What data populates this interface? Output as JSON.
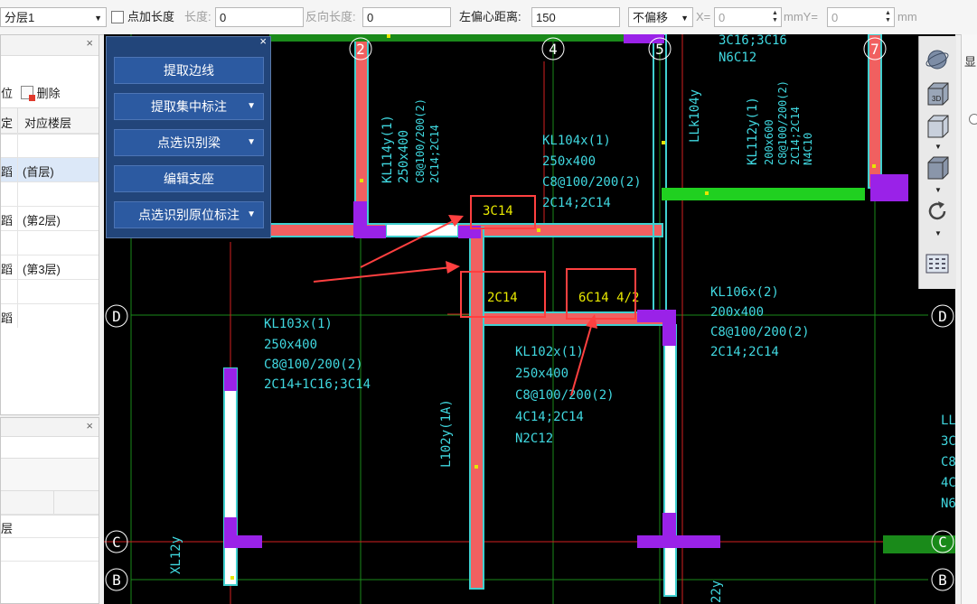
{
  "toolbar": {
    "layer_select": "分层1",
    "point_length_label": "点加长度",
    "length_label": "长度:",
    "length_value": "0",
    "reverse_length_label": "反向长度:",
    "reverse_length_value": "0",
    "left_offset_label": "左偏心距离:",
    "left_offset_value": "150",
    "offset_select": "不偏移",
    "x_label": "X=",
    "x_value": "0",
    "mm_y_label": "mmY=",
    "y_value": "0",
    "mm_label": "mm"
  },
  "left_panel": {
    "locate_label": "位",
    "delete_label": "删除",
    "col_lock": "定",
    "col_floor": "对应楼层",
    "rows": [
      {
        "a": "",
        "b": ""
      },
      {
        "a": "蹈",
        "b": "(首层)"
      },
      {
        "a": "",
        "b": ""
      },
      {
        "a": "蹈",
        "b": "(第2层)"
      },
      {
        "a": "",
        "b": ""
      },
      {
        "a": "蹈",
        "b": "(第3层)"
      },
      {
        "a": "",
        "b": ""
      },
      {
        "a": "蹈",
        "b": ""
      }
    ]
  },
  "left_panel2": {
    "row1": "层"
  },
  "floating_menu": {
    "items": [
      {
        "label": "提取边线",
        "dropdown": false
      },
      {
        "label": "提取集中标注",
        "dropdown": true
      },
      {
        "label": "点选识别梁",
        "dropdown": true
      },
      {
        "label": "编辑支座",
        "dropdown": false
      },
      {
        "label": "点选识别原位标注",
        "dropdown": true
      }
    ]
  },
  "right_strip": {
    "label": "显"
  },
  "drawing": {
    "axis_labels": {
      "a2": "2",
      "a4": "4",
      "a5": "5",
      "a7": "7",
      "d_left": "D",
      "d_right": "D",
      "c_left": "C",
      "c_right": "C",
      "b_left": "B",
      "b_right": "B"
    },
    "top_right_note": [
      "3C16;3C16",
      "N6C12"
    ],
    "kl114": [
      "KL114y(1)",
      "250x400",
      "C8@100/200(2)",
      "2C14;2C14"
    ],
    "kl104": [
      "KL104x(1)",
      "250x400",
      "C8@100/200(2)",
      "2C14;2C14"
    ],
    "llk104": "LLk104y",
    "kl112": [
      "KL112y(1)",
      "200x600",
      "C8@100/200(2)",
      "2C14;2C14",
      "N4C10"
    ],
    "kl106": [
      "KL106x(2)",
      "200x400",
      "C8@100/200(2)",
      "2C14;2C14"
    ],
    "kl103": [
      "KL103x(1)",
      "250x400",
      "C8@100/200(2)",
      "2C14+1C16;3C14"
    ],
    "kl102": [
      "KL102x(1)",
      "250x400",
      "C8@100/200(2)",
      "4C14;2C14",
      "N2C12"
    ],
    "l102": "L102y(1A)",
    "xl12": "XL12y",
    "b22": "22y",
    "right_partial": [
      "LL",
      "3C",
      "C8",
      "4C",
      "N6"
    ],
    "highlight_3c14": "3C14",
    "highlight_2c14": "2C14",
    "highlight_6c14": "6C14 4/2"
  }
}
